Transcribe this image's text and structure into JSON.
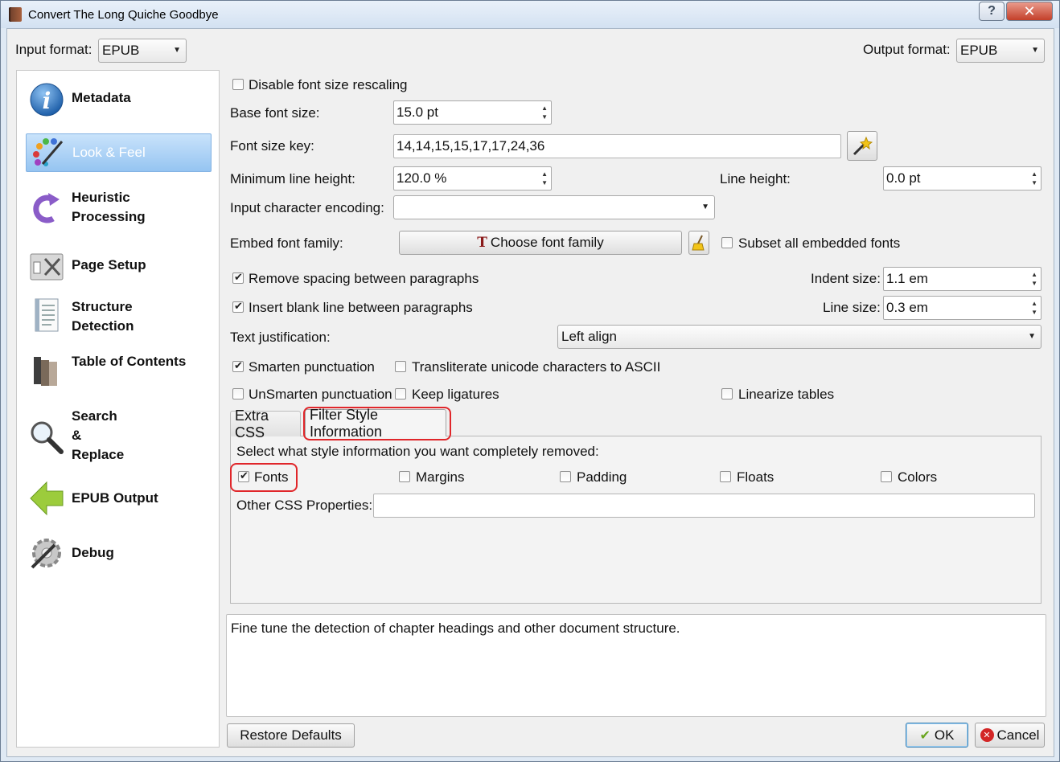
{
  "window": {
    "title": "Convert The Long Quiche Goodbye",
    "help_label": "?",
    "close_label": "✕"
  },
  "formats": {
    "input_label": "Input format:",
    "input_value": "EPUB",
    "output_label": "Output format:",
    "output_value": "EPUB"
  },
  "sidebar": {
    "items": [
      {
        "label": "Metadata",
        "icon": "info-icon"
      },
      {
        "label": "Look & Feel",
        "icon": "palette-icon"
      },
      {
        "label": "Heuristic Processing",
        "icon": "circular-arrow-icon"
      },
      {
        "label": "Page Setup",
        "icon": "page-setup-icon"
      },
      {
        "label": "Structure Detection",
        "icon": "document-icon"
      },
      {
        "label": "Table of Contents",
        "icon": "books-icon"
      },
      {
        "label": "Search & Replace",
        "icon": "magnifier-icon"
      },
      {
        "label": "EPUB Output",
        "icon": "green-arrow-icon"
      },
      {
        "label": "Debug",
        "icon": "debug-gear-icon"
      }
    ],
    "active_index": 1
  },
  "look_feel": {
    "disable_rescaling": {
      "label": "Disable font size rescaling",
      "checked": false
    },
    "base_font_size": {
      "label": "Base font size:",
      "value": "15.0 pt"
    },
    "font_size_key": {
      "label": "Font size key:",
      "value": "14,14,15,15,17,17,24,36"
    },
    "min_line_height": {
      "label": "Minimum line height:",
      "value": "120.0 %"
    },
    "line_height": {
      "label": "Line height:",
      "value": "0.0 pt"
    },
    "input_encoding": {
      "label": "Input character encoding:",
      "value": ""
    },
    "embed_font": {
      "label": "Embed font family:",
      "button": "Choose font family"
    },
    "subset_fonts": {
      "label": "Subset all embedded fonts",
      "checked": false
    },
    "remove_spacing": {
      "label": "Remove spacing between paragraphs",
      "checked": true
    },
    "indent_size": {
      "label": "Indent size:",
      "value": "1.1 em"
    },
    "insert_blank": {
      "label": "Insert blank line between paragraphs",
      "checked": true
    },
    "line_size": {
      "label": "Line size:",
      "value": "0.3 em"
    },
    "justification": {
      "label": "Text justification:",
      "value": "Left align"
    },
    "smarten": {
      "label": "Smarten punctuation",
      "checked": true
    },
    "transliterate": {
      "label": "Transliterate unicode characters to ASCII",
      "checked": false
    },
    "unsmarten": {
      "label": "UnSmarten punctuation",
      "checked": false
    },
    "keep_ligatures": {
      "label": "Keep ligatures",
      "checked": false
    },
    "linearize": {
      "label": "Linearize tables",
      "checked": false
    }
  },
  "tabs": {
    "extra_css": "Extra CSS",
    "filter_style": "Filter Style Information",
    "active": "filter_style"
  },
  "filter": {
    "prompt": "Select what style information you want completely removed:",
    "fonts": {
      "label": "Fonts",
      "checked": true
    },
    "margins": {
      "label": "Margins",
      "checked": false
    },
    "padding": {
      "label": "Padding",
      "checked": false
    },
    "floats": {
      "label": "Floats",
      "checked": false
    },
    "colors": {
      "label": "Colors",
      "checked": false
    },
    "other_css": {
      "label": "Other CSS Properties:",
      "value": ""
    }
  },
  "description": "Fine tune the detection of chapter headings and other document structure.",
  "footer": {
    "restore": "Restore Defaults",
    "ok": "OK",
    "cancel": "Cancel"
  },
  "colors": {
    "highlight_ring": "#e0262a",
    "active_nav": "#95c4f1"
  }
}
